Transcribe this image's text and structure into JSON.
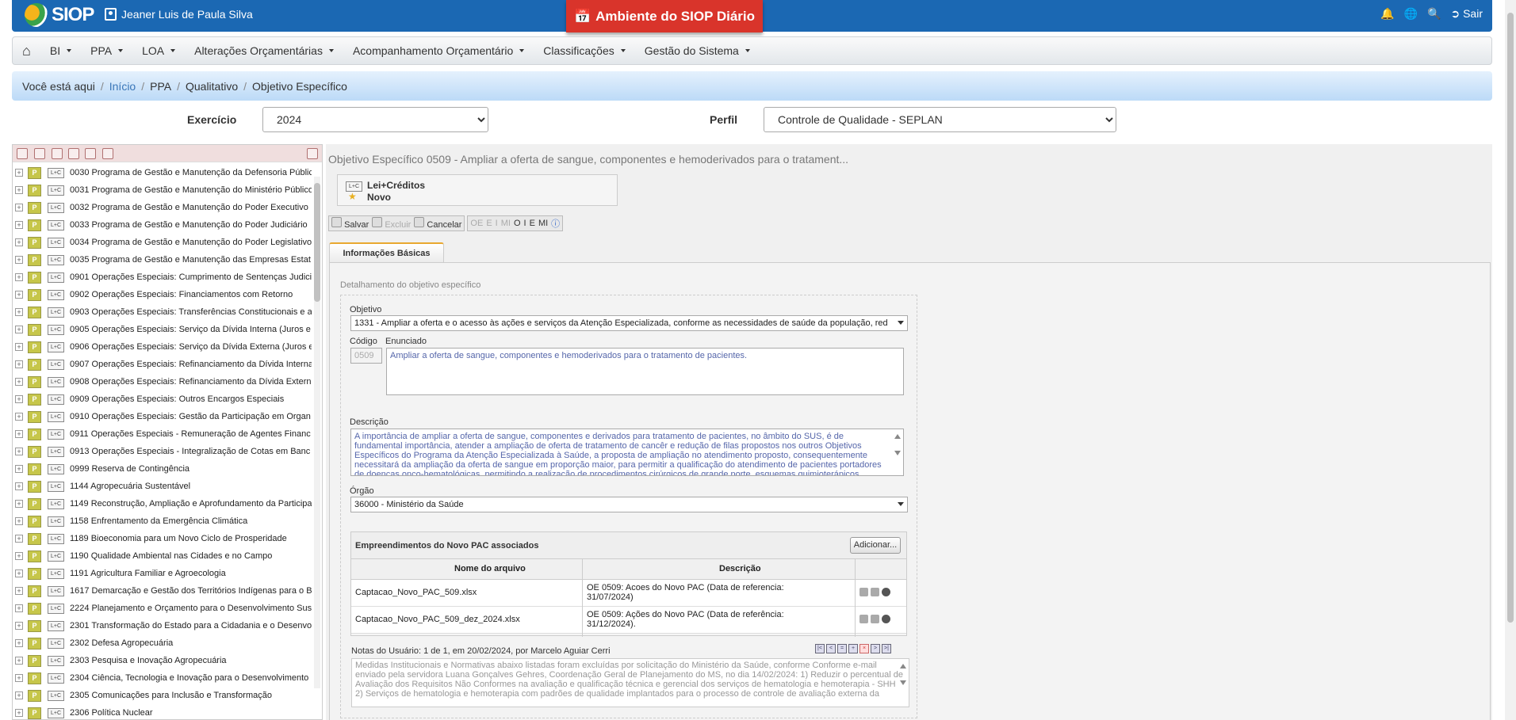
{
  "app": {
    "logo_text": "SIOP",
    "user_name": "Jeaner Luis de Paula Silva",
    "environment": "Ambiente do SIOP Diário",
    "exit_label": "Sair"
  },
  "nav": [
    {
      "label": "BI"
    },
    {
      "label": "PPA"
    },
    {
      "label": "LOA"
    },
    {
      "label": "Alterações Orçamentárias"
    },
    {
      "label": "Acompanhamento Orçamentário"
    },
    {
      "label": "Classificações"
    },
    {
      "label": "Gestão do Sistema"
    }
  ],
  "breadcrumb": {
    "prefix": "Você está aqui",
    "items": [
      "Início",
      "PPA",
      "Qualitativo",
      "Objetivo Específico"
    ]
  },
  "filters": {
    "exercicio_label": "Exercício",
    "exercicio_value": "2024",
    "perfil_label": "Perfil",
    "perfil_value": "Controle de Qualidade - SEPLAN"
  },
  "tree": [
    "0030 Programa de Gestão e Manutenção da Defensoria Públic",
    "0031 Programa de Gestão e Manutenção do Ministério Público",
    "0032 Programa de Gestão e Manutenção do Poder Executivo",
    "0033 Programa de Gestão e Manutenção do Poder Judiciário",
    "0034 Programa de Gestão e Manutenção do Poder Legislativo",
    "0035 Programa de Gestão e Manutenção das Empresas Estat",
    "0901 Operações Especiais: Cumprimento de Sentenças Judici",
    "0902 Operações Especiais: Financiamentos com Retorno",
    "0903 Operações Especiais: Transferências Constitucionais e a",
    "0905 Operações Especiais: Serviço da Dívida Interna (Juros e",
    "0906 Operações Especiais: Serviço da Dívida Externa (Juros e",
    "0907 Operações Especiais: Refinanciamento da Dívida Interna",
    "0908 Operações Especiais: Refinanciamento da Dívida Extern",
    "0909 Operações Especiais: Outros Encargos Especiais",
    "0910 Operações Especiais: Gestão da Participação em Organ",
    "0911 Operações Especiais - Remuneração de Agentes Financ",
    "0913 Operações Especiais - Integralização de Cotas em Banc",
    "0999 Reserva de Contingência",
    "1144 Agropecuária Sustentável",
    "1149 Reconstrução, Ampliação e Aprofundamento da Participa",
    "1158 Enfrentamento da Emergência Climática",
    "1189 Bioeconomia para um Novo Ciclo de Prosperidade",
    "1190 Qualidade Ambiental nas Cidades e no Campo",
    "1191 Agricultura Familiar e Agroecologia",
    "1617 Demarcação e Gestão dos Territórios Indígenas para o B",
    "2224 Planejamento e Orçamento para o Desenvolvimento Sus",
    "2301 Transformação do Estado para a Cidadania e o Desenvo",
    "2302 Defesa Agropecuária",
    "2303 Pesquisa e Inovação Agropecuária",
    "2304 Ciência, Tecnologia e Inovação para o Desenvolvimento",
    "2305 Comunicações para Inclusão e Transformação",
    "2306 Política Nuclear"
  ],
  "tree_badges": {
    "p": "P",
    "lc": "L+C"
  },
  "detail": {
    "title": "Objetivo Específico 0509 - Ampliar a oferta de sangue, componentes e hemoderivados para o tratament...",
    "lc_label": "Lei+Créditos",
    "lc_status": "Novo",
    "toolbar": {
      "save": "Salvar",
      "delete": "Excluir",
      "cancel": "Cancelar",
      "oe": "OE",
      "e": "E",
      "i": "I",
      "mi": "MI",
      "o": "O"
    },
    "tab": "Informações Básicas",
    "section": "Detalhamento do objetivo específico",
    "objetivo_label": "Objetivo",
    "objetivo_value": "1331 - Ampliar a oferta e o acesso às ações e serviços da Atenção Especializada, conforme as necessidades de saúde da população, red",
    "codigo_label": "Código",
    "codigo_value": "0509",
    "enunciado_label": "Enunciado",
    "enunciado_value": "Ampliar a oferta de sangue, componentes e hemoderivados para o tratamento de pacientes.",
    "descricao_label": "Descrição",
    "descricao_value": "A importância de ampliar a oferta de sangue, componentes e derivados para tratamento de pacientes, no âmbito do SUS, é de fundamental importância, atender a ampliação de oferta de tratamento de cancêr e redução de filas propostos nos outros Objetivos Específicos do Programa da Atenção Especializada à Saúde, a proposta de ampliação no atendimento proposto, consequentemente necessitará da ampliação da oferta de sangue em proporção maior, para permitir a qualificação do atendimento de pacientes portadores de doenças onco-hematológicas, permitindo a realização de procedimentos cirúrgicos de grande porte, esquemas quimioterápicos agressivos e estratégias",
    "orgao_label": "Órgão",
    "orgao_value": "36000 - Ministério da Saúde",
    "pac_title": "Empreendimentos do Novo PAC associados",
    "add_button": "Adicionar...",
    "grid_cols": [
      "Nome do arquivo",
      "Descrição"
    ],
    "grid_rows": [
      {
        "file": "Captacao_Novo_PAC_509.xlsx",
        "desc1": "OE 0509: Acoes do Novo PAC (Data de referencia:",
        "desc2": "31/07/2024)"
      },
      {
        "file": "Captacao_Novo_PAC_509_dez_2024.xlsx",
        "desc1": "OE 0509: Ações do Novo PAC (Data de referência:",
        "desc2": "31/12/2024)."
      }
    ],
    "notes_label": "Notas do Usuário: 1 de 1, em 20/02/2024, por Marcelo Aguiar Cerri",
    "notes_value": "Medidas Institucionais e Normativas abaixo listadas foram excluídas por solicitação do Ministério da Saúde, conforme Conforme e-mail enviado pela servidora Luana Gonçalves Gehres, Coordenação Geral de Planejamento do MS, no dia 14/02/2024: 1) Reduzir o percentual de Avaliação dos Requisitos Não Conformes na avaliação e qualificação técnica e gerencial dos serviços de hematologia e hemoterapia - SHH 2) Serviços de hematologia e hemoterapia com padrões de qualidade implantados para o processo de controle de avaliação externa da"
  },
  "colors": {
    "topbar": "#1b68b3",
    "env": "#d9342b",
    "breadcrumb": "#cfe4fa",
    "badge_p": "#c6c64a"
  }
}
